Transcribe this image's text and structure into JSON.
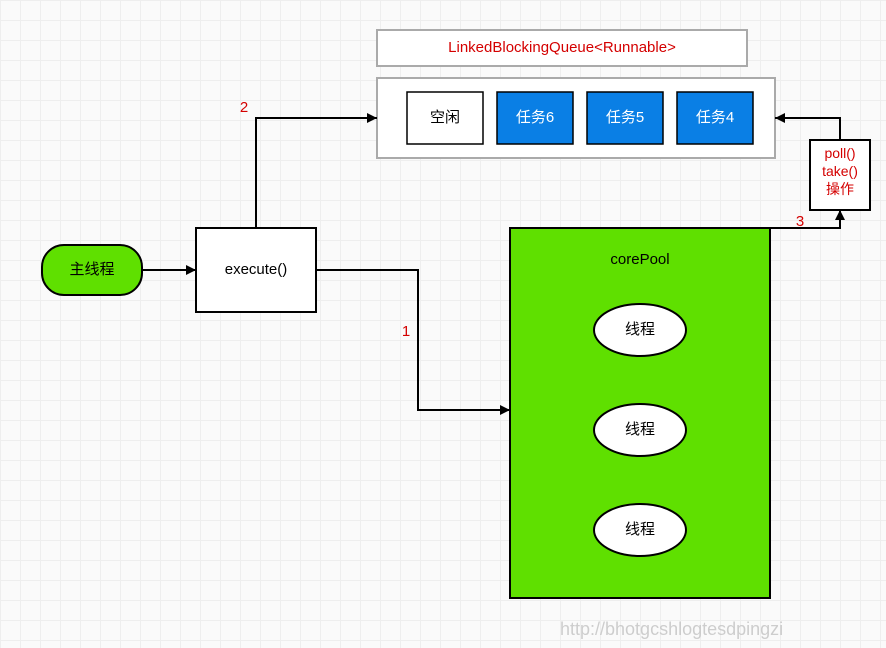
{
  "queue": {
    "title": "LinkedBlockingQueue<Runnable>",
    "slots": [
      "空闲",
      "任务6",
      "任务5",
      "任务4"
    ]
  },
  "mainThread": {
    "label": "主线程"
  },
  "executeBox": {
    "label": "execute()"
  },
  "corePool": {
    "title": "corePool",
    "threads": [
      "线程",
      "线程",
      "线程"
    ]
  },
  "pollBox": {
    "lines": [
      "poll()",
      "take()",
      "操作"
    ]
  },
  "edgeLabels": {
    "e1": "1",
    "e2": "2",
    "e3": "3"
  },
  "watermark": "http://bhotgcshlogtesdpingzi"
}
